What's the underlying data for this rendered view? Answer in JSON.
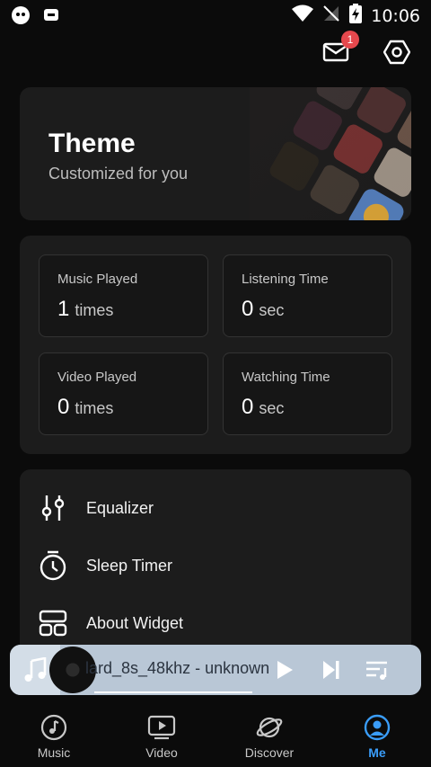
{
  "status_bar": {
    "time": "10:06"
  },
  "header": {
    "mail_badge": "1"
  },
  "theme_card": {
    "title": "Theme",
    "subtitle": "Customized for you"
  },
  "stats": [
    {
      "label": "Music Played",
      "value": "1",
      "unit": "times"
    },
    {
      "label": "Listening Time",
      "value": "0",
      "unit": "sec"
    },
    {
      "label": "Video Played",
      "value": "0",
      "unit": "times"
    },
    {
      "label": "Watching Time",
      "value": "0",
      "unit": "sec"
    }
  ],
  "menu": [
    {
      "label": "Equalizer",
      "icon": "equalizer-icon"
    },
    {
      "label": "Sleep Timer",
      "icon": "timer-icon"
    },
    {
      "label": "About Widget",
      "icon": "widget-icon"
    }
  ],
  "player": {
    "title": "lard_8s_48khz - unknown",
    "progress": 0.45
  },
  "nav": [
    {
      "label": "Music",
      "icon": "music-icon"
    },
    {
      "label": "Video",
      "icon": "video-icon"
    },
    {
      "label": "Discover",
      "icon": "planet-icon"
    },
    {
      "label": "Me",
      "icon": "profile-icon"
    }
  ],
  "colors": {
    "accent": "#3a9dfa",
    "badge": "#e5484d",
    "player_bg": "#b9c7d6"
  }
}
